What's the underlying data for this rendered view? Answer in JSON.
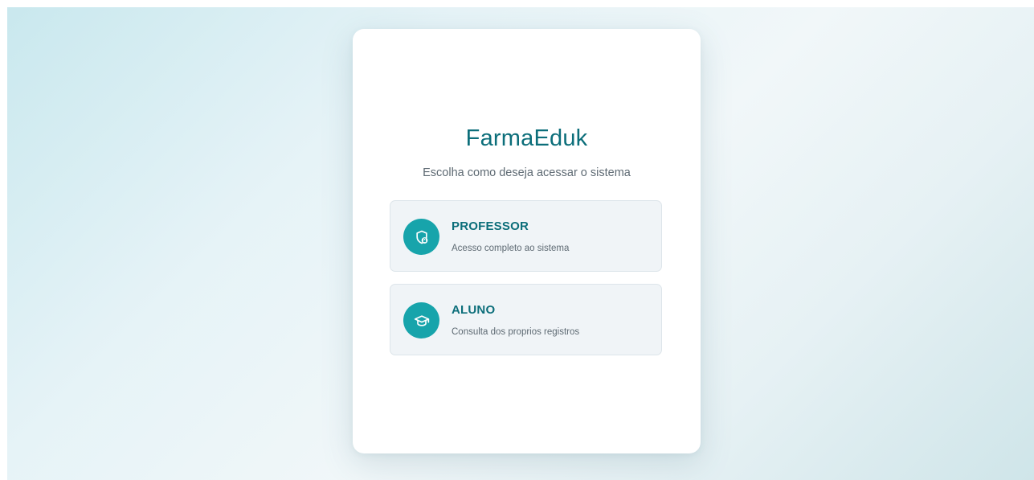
{
  "app": {
    "brand": "FarmaEduk",
    "subtitle": "Escolha como deseja acessar o sistema"
  },
  "options": [
    {
      "title": "PROFESSOR",
      "description": "Acesso completo ao sistema",
      "icon": "shield-lock-icon"
    },
    {
      "title": "ALUNO",
      "description": "Consulta dos proprios registros",
      "icon": "graduation-cap-icon"
    }
  ],
  "colors": {
    "accent": "#17a4ab",
    "brand_text": "#0c6e7a"
  }
}
